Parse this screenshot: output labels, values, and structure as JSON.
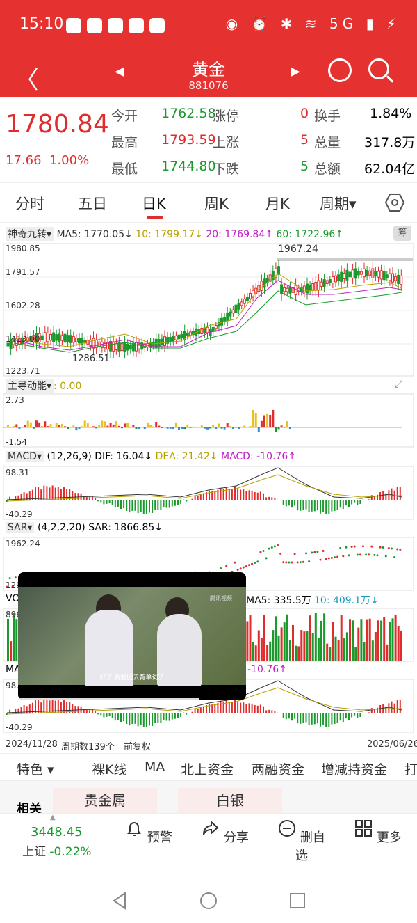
{
  "status_bar": {
    "time": "15:10",
    "network": "5G"
  },
  "header": {
    "title": "黄金",
    "code": "881076"
  },
  "quote": {
    "price": "1780.84",
    "change": "17.66",
    "change_pct": "1.00%",
    "rows": [
      {
        "l1": "今开",
        "v1": "1762.58",
        "l2": "涨停",
        "v2": "0",
        "l3": "换手",
        "v3": "1.84%"
      },
      {
        "l1": "最高",
        "v1": "1793.59",
        "l2": "上涨",
        "v2": "5",
        "l3": "总量",
        "v3": "317.8万"
      },
      {
        "l1": "最低",
        "v1": "1744.80",
        "l2": "下跌",
        "v2": "5",
        "l3": "总额",
        "v3": "62.04亿"
      }
    ]
  },
  "tabs": [
    "分时",
    "五日",
    "日K",
    "周K",
    "月K",
    "周期"
  ],
  "active_tab": "日K",
  "main_chart": {
    "indicator": "神奇九转",
    "ma5": "MA5: 1770.05↓",
    "ma10": "10: 1799.17↓",
    "ma20": "20: 1769.84↑",
    "ma60": "60: 1722.96↑",
    "chou": "筹",
    "y_max": "1980.85",
    "y2": "1791.57",
    "y3": "1602.28",
    "y4": "1413.00",
    "y_min": "1223.71",
    "hi_marker": "1967.24",
    "lo_marker": "1286.51"
  },
  "flow_chart": {
    "name": "主导动能",
    "value": ": 0.00",
    "y_max": "2.73",
    "y_min": "-1.54"
  },
  "macd_chart": {
    "name": "MACD",
    "params": "(12,26,9)",
    "dif": "DIF: 16.04↓",
    "dea": "DEA: 21.42↓",
    "macd": "MACD: -10.76↑",
    "y_max": "98.31",
    "y_min": "-40.29"
  },
  "sar_chart": {
    "name": "SAR",
    "params": "(4,2,2,20)",
    "sar": "SAR: 1866.85↓",
    "y_max": "1962.24",
    "y_min": "129"
  },
  "vol_chart": {
    "name": "VO",
    "ma5": "MA5: 335.5万",
    "ma10": "10: 409.1万↓",
    "y_max": "896"
  },
  "macd2_chart": {
    "name": "MA",
    "macd": "-10.76↑",
    "y_max": "98.",
    "y_min": "-40.29"
  },
  "video": {
    "subtitle": "好了 我要回去背单词了",
    "watermark": "腾讯视频"
  },
  "date_bar": {
    "start": "2024/11/28",
    "count": "周期数139个",
    "adjust": "前复权",
    "end": "2025/06/26"
  },
  "features": [
    "特色",
    "裸K线",
    "MA",
    "北上资金",
    "两融资金",
    "增减持资金",
    "打"
  ],
  "related": {
    "title": "相关",
    "chips": [
      "贵金属",
      "白银"
    ]
  },
  "bottom_nav": {
    "index_value": "3448.45",
    "index_name": "上证",
    "index_change": "-0.22%",
    "items": [
      "预警",
      "分享",
      "删自选",
      "更多"
    ]
  }
}
